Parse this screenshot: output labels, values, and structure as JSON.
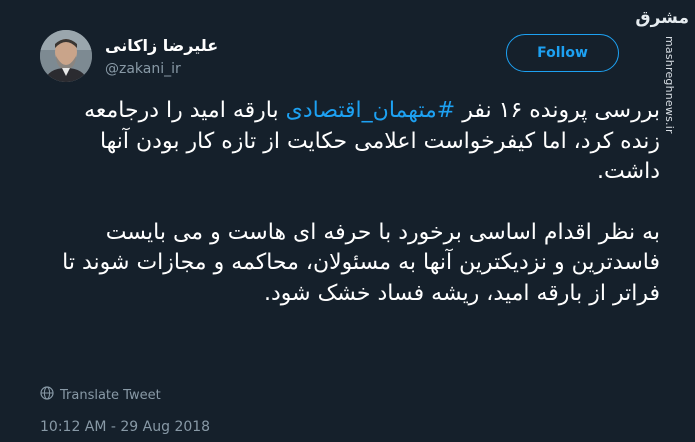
{
  "author": {
    "name": "علیرضا زاکانی",
    "handle": "@zakani_ir"
  },
  "follow_label": "Follow",
  "watermark": {
    "logo": "مشرق",
    "url": "mashreghnews.ir"
  },
  "tweet": {
    "p1_before": "بررسی پرونده ۱۶ نفر ",
    "hashtag": "#متهمان_اقتصادی",
    "p1_after": " بارقه امید را درجامعه زنده کرد، اما کیفرخواست اعلامی حکایت از تازه کار بودن آنها داشت.",
    "p2": "به نظر اقدام اساسی برخورد با حرفه ای هاست و می بایست  فاسدترین و نزدیکترین آنها به مسئولان، محاکمه و مجازات شوند تا فراتر از بارقه امید، ریشه فساد خشک شود."
  },
  "translate_label": "Translate Tweet",
  "timestamp": "10:12 AM - 29 Aug 2018",
  "colors": {
    "background": "#15202b",
    "accent": "#1da1f2",
    "secondary_text": "#8899a6"
  },
  "icons": {
    "translate": "globe-icon"
  }
}
